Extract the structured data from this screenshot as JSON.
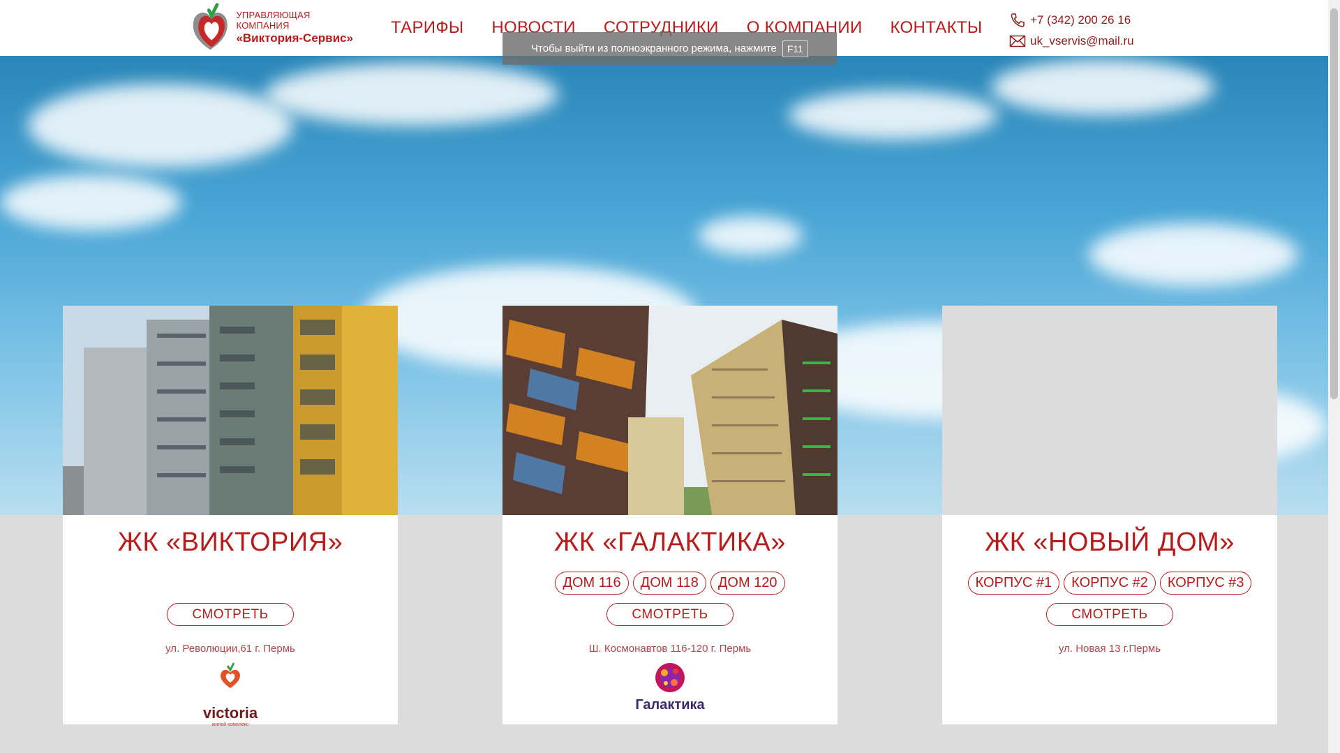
{
  "header": {
    "logo_line1": "УПРАВЛЯЮЩАЯ КОМПАНИЯ",
    "logo_line2": "«Виктория-Сервис»",
    "nav": [
      "ТАРИФЫ",
      "НОВОСТИ",
      "СОТРУДНИКИ",
      "О КОМПАНИИ",
      "КОНТАКТЫ"
    ],
    "phone": "+7 (342) 200 26 16",
    "email": "uk_vservis@mail.ru"
  },
  "toast": {
    "text": "Чтобы выйти из полноэкранного режима, нажмите",
    "key": "F11"
  },
  "cards": [
    {
      "title": "ЖК «ВИКТОРИЯ»",
      "pills": [],
      "button": "СМОТРЕТЬ",
      "address": "ул. Революции,61 г. Пермь",
      "brand": "victoria",
      "brand_sub": "жилой комплекс"
    },
    {
      "title": "ЖК «ГАЛАКТИКА»",
      "pills": [
        "ДОМ 116",
        "ДОМ 118",
        "ДОМ 120"
      ],
      "button": "СМОТРЕТЬ",
      "address": "Ш. Космонавтов 116-120 г. Пермь",
      "brand": "Галактика"
    },
    {
      "title": "ЖК «НОВЫЙ ДОМ»",
      "pills": [
        "КОРПУС #1",
        "КОРПУС #2",
        "КОРПУС #3"
      ],
      "button": "СМОТРЕТЬ",
      "address": "ул. Новая 13 г.Пермь"
    }
  ],
  "colors": {
    "accent": "#b71c1c",
    "background": "#dcdcdc"
  }
}
